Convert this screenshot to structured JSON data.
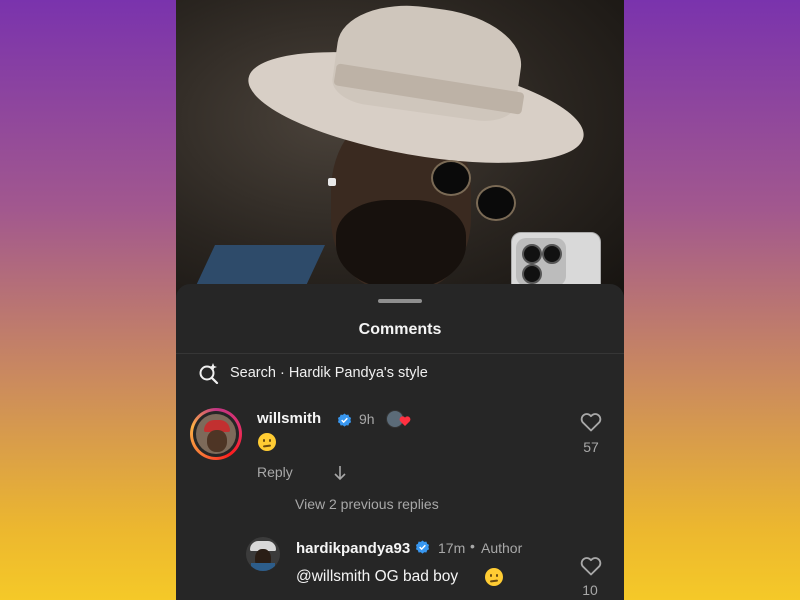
{
  "sheet": {
    "title": "Comments",
    "search_label": "Search · Hardik Pandya's style"
  },
  "comments": [
    {
      "username": "willsmith",
      "verified": true,
      "time": "9h",
      "reply_label": "Reply",
      "likes": "57"
    }
  ],
  "view_replies_label": "View 2 previous replies",
  "replies": [
    {
      "username": "hardikpandya93",
      "verified": true,
      "time": "17m",
      "separator": "•",
      "badge": "Author",
      "text": "@willsmith OG bad boy",
      "likes": "10"
    }
  ],
  "colors": {
    "verified_blue": "#3897f0",
    "heart_red": "#ff3040"
  }
}
